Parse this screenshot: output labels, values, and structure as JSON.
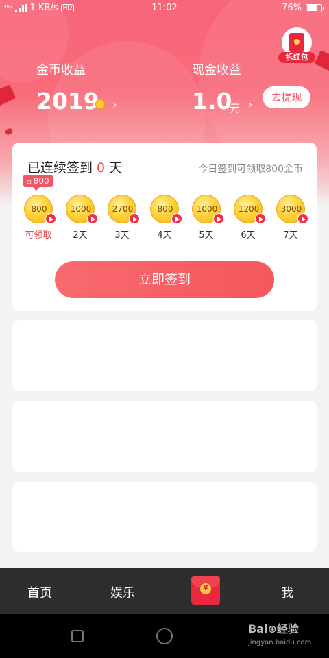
{
  "status_bar": {
    "network": "⁴⁶ᴳ",
    "speed": "1 KB/s",
    "hd": "HD",
    "time": "11:02",
    "battery": "76%",
    "battery_level": 0.76
  },
  "red_packet": {
    "label": "拆红包"
  },
  "earnings": {
    "gold_label": "金币收益",
    "gold_value": "2019",
    "cash_label": "现金收益",
    "cash_value": "1.0",
    "cash_unit": "元",
    "withdraw_label": "去提现",
    "chevron": "›"
  },
  "sign_in": {
    "title_prefix": "已连续签到",
    "streak_days": "0",
    "title_suffix": "天",
    "hint": "今日签到可领取800金币",
    "today_tag": "800",
    "today_tag_mini": "⊟",
    "days": [
      {
        "amount": "800",
        "label": "可领取"
      },
      {
        "amount": "1000",
        "label": "2天"
      },
      {
        "amount": "2700",
        "label": "3天"
      },
      {
        "amount": "800",
        "label": "4天"
      },
      {
        "amount": "1000",
        "label": "5天"
      },
      {
        "amount": "1200",
        "label": "6天"
      },
      {
        "amount": "3000",
        "label": "7天"
      }
    ],
    "button_label": "立即签到"
  },
  "tab_bar": {
    "home": "首页",
    "entertainment": "娱乐",
    "red_packet_symbol": "¥",
    "me": "我"
  },
  "watermark": {
    "logo": "Bai⊕经验",
    "url": "jingyan.baidu.com"
  },
  "colors": {
    "accent": "#f25563",
    "highlight": "#f04a4a",
    "tab_bar": "#2e2e2e"
  }
}
